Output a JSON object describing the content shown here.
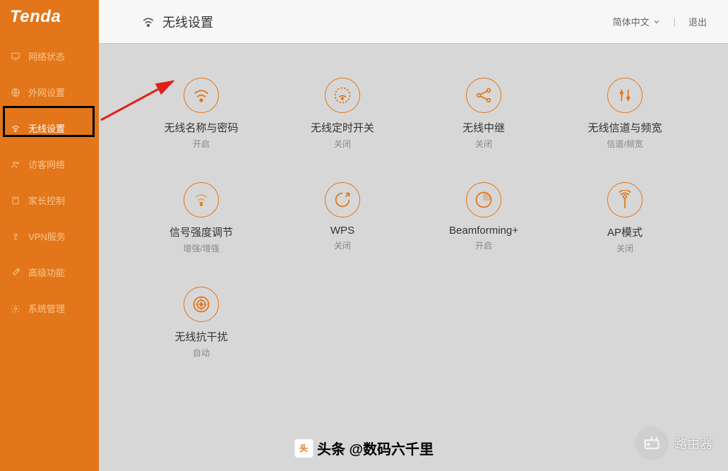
{
  "logo": "Tenda",
  "sidebar": {
    "items": [
      {
        "label": "网络状态",
        "icon": "monitor-icon"
      },
      {
        "label": "外网设置",
        "icon": "globe-icon"
      },
      {
        "label": "无线设置",
        "icon": "wifi-icon",
        "active": true
      },
      {
        "label": "访客网络",
        "icon": "users-icon"
      },
      {
        "label": "家长控制",
        "icon": "shield-icon"
      },
      {
        "label": "VPN服务",
        "icon": "vpn-icon"
      },
      {
        "label": "高级功能",
        "icon": "tools-icon"
      },
      {
        "label": "系统管理",
        "icon": "gear-icon"
      }
    ]
  },
  "header": {
    "title": "无线设置",
    "language": "简体中文",
    "logout": "退出"
  },
  "cards": [
    {
      "title": "无线名称与密码",
      "sub": "开启",
      "icon": "wifi"
    },
    {
      "title": "无线定时开关",
      "sub": "关闭",
      "icon": "clock"
    },
    {
      "title": "无线中继",
      "sub": "关闭",
      "icon": "relay"
    },
    {
      "title": "无线信道与频宽",
      "sub": "信道/频宽",
      "icon": "channel"
    },
    {
      "title": "信号强度调节",
      "sub": "增强/增强",
      "icon": "signal"
    },
    {
      "title": "WPS",
      "sub": "关闭",
      "icon": "wps"
    },
    {
      "title": "Beamforming+",
      "sub": "开启",
      "icon": "beam"
    },
    {
      "title": "AP模式",
      "sub": "关闭",
      "icon": "ap"
    },
    {
      "title": "无线抗干扰",
      "sub": "自动",
      "icon": "target"
    }
  ],
  "watermark": "路由器",
  "attribution": "头条 @数码六千里"
}
